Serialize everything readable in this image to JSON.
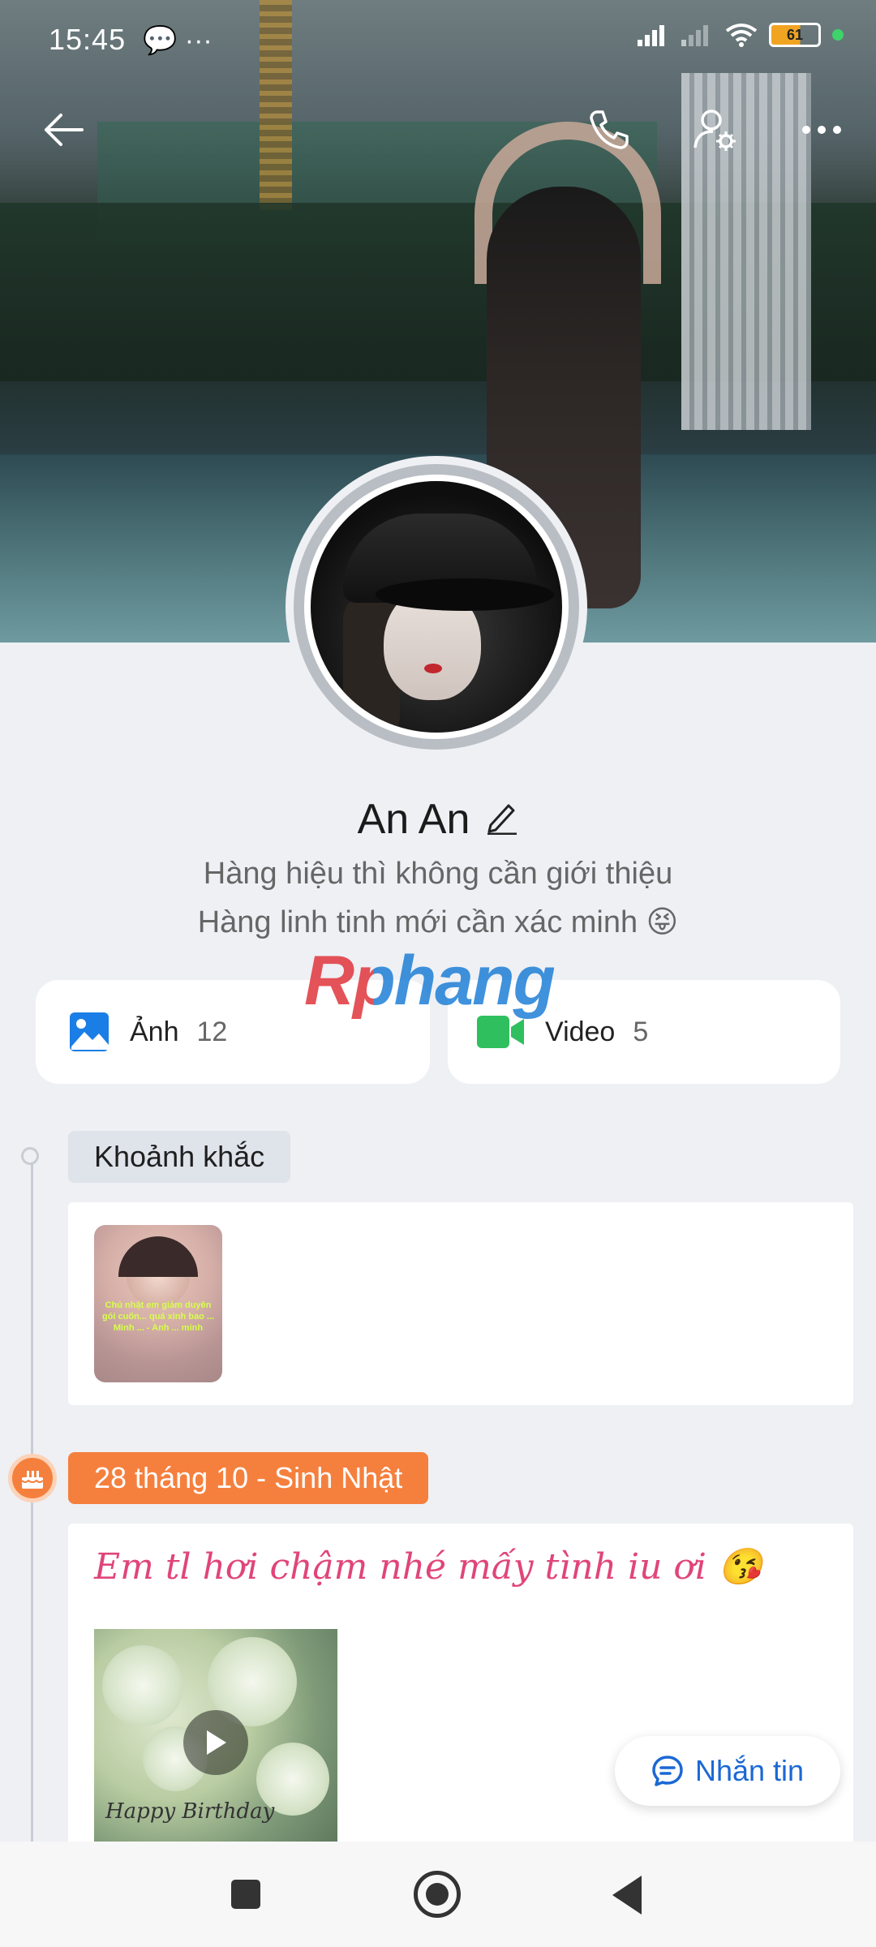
{
  "status": {
    "time": "15:45",
    "left_icons": "💬 ···",
    "battery": "61"
  },
  "topbar": {
    "back_icon": "arrow-left-icon",
    "call_icon": "phone-icon",
    "settings_icon": "user-settings-icon",
    "more_icon": "more-horizontal-icon"
  },
  "profile": {
    "name": "An An",
    "bio_line1": "Hàng hiệu thì không cần giới thiệu",
    "bio_line2": "Hàng linh tinh mới cần xác minh 😝"
  },
  "watermark": "Rphang",
  "media": {
    "photos": {
      "label": "Ảnh",
      "count": "12"
    },
    "videos": {
      "label": "Video",
      "count": "5"
    }
  },
  "timeline": {
    "moments_tag": "Khoảnh khắc",
    "moment_caption": "Chủ nhật em giảm duyên gói cuốn... quá xinh bao ...\n Mình ... - Anh ... minh",
    "birthday_tag": "28 tháng 10 - Sinh Nhật",
    "post_text": "Em tl hơi chậm nhé mấy tình iu ơi 😘",
    "video_caption": "Happy Birthday"
  },
  "message_button": {
    "label": "Nhắn tin"
  },
  "colors": {
    "accent": "#1a68d4",
    "birthday": "#f5803e",
    "video_icon": "#2fbf5f",
    "photo_icon": "#1a7ee6"
  }
}
